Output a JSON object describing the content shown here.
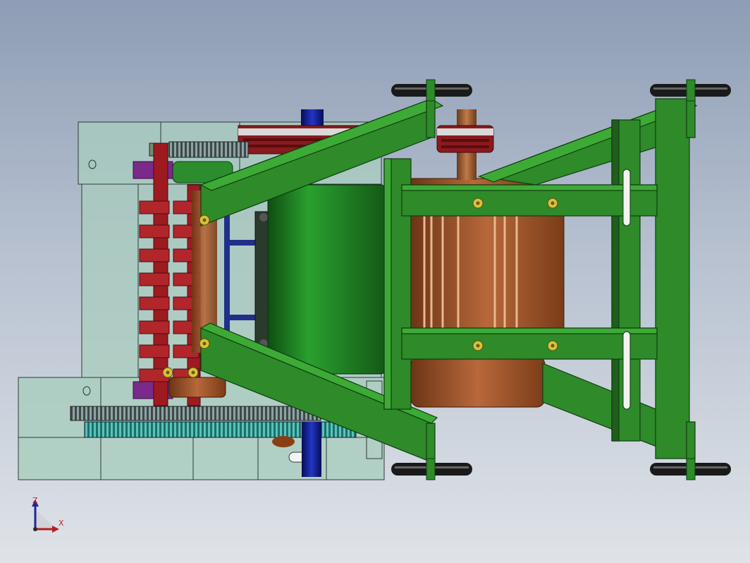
{
  "triad": {
    "z_label": "Z",
    "x_label": "X"
  },
  "colors": {
    "frame": "#2f8a2a",
    "frame_dark": "#1f5e1b",
    "motor": "#1f7a22",
    "copper": "#a2562a",
    "housing": "#9fc2b4",
    "roller": "#b31f24",
    "gear": "#2f8f8a",
    "wheel": "#1a1a1a",
    "shaft_blue": "#0d1a8c",
    "purple": "#7a2a8a",
    "bolt": "#d7c23a"
  },
  "icons": {
    "triad": "coordinate-triad-icon"
  }
}
